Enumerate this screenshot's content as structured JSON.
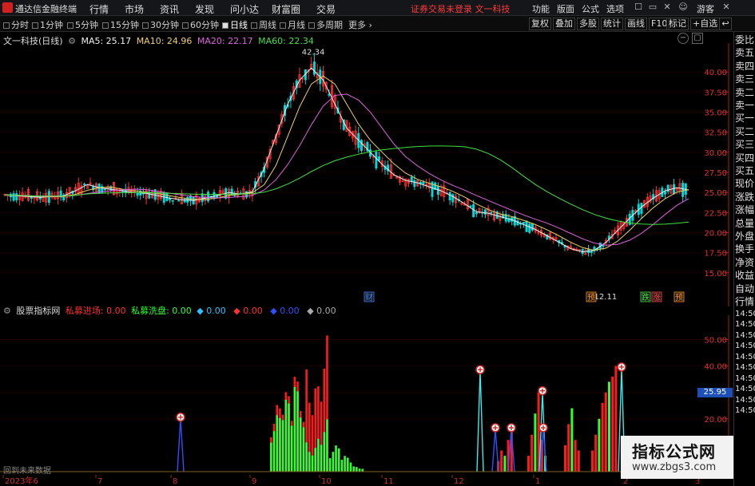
{
  "titlebar": {
    "app_name": "通达信金融终端",
    "menus": [
      "行情",
      "市场",
      "资讯",
      "发现",
      "问小达",
      "财富圈",
      "交易"
    ],
    "notice": "证券交易未登录 文一科技",
    "right_menus": [
      "功能",
      "版面",
      "公式",
      "选项"
    ],
    "search_label": "游客"
  },
  "toolbar": {
    "periods": [
      "分时",
      "1分钟",
      "5分钟",
      "15分钟",
      "30分钟",
      "60分钟",
      "日线",
      "周线",
      "月线",
      "多周期",
      "更多"
    ],
    "active_period": "日线",
    "right_buttons": [
      "复权",
      "叠加",
      "多股",
      "统计",
      "画线",
      "F10",
      "标记",
      "+自选"
    ],
    "back_icon": "back-arrow-icon"
  },
  "main_header": {
    "stock": "文一科技(日线)",
    "ma5": "MA5: 25.17",
    "ma10": "MA10: 24.96",
    "ma20": "MA20: 22.17",
    "ma60": "MA60: 22.34",
    "colors": {
      "ma5": "#f0f0f0",
      "ma10": "#f0d060",
      "ma20": "#e060e0",
      "ma60": "#40e040"
    }
  },
  "sub_header": {
    "name": "股票指标网",
    "items": [
      {
        "label": "私募进场: 0.00",
        "color": "#ff3030"
      },
      {
        "label": "私募洗盘: 0.00",
        "color": "#30ff30"
      },
      {
        "label": "0.00",
        "color": "#30c0ff"
      },
      {
        "label": "0.00",
        "color": "#ff3030"
      },
      {
        "label": "0.00",
        "color": "#3050ff"
      },
      {
        "label": "0.00",
        "color": "#aaaaaa"
      }
    ]
  },
  "price_axis": [
    "40.00",
    "37.50",
    "35.00",
    "32.50",
    "30.00",
    "27.50",
    "25.00",
    "22.50",
    "20.00",
    "17.50",
    "15.00"
  ],
  "sub_axis": [
    "50.00",
    "40.00",
    "30.00",
    "20.00"
  ],
  "date_axis": [
    "2023年6",
    "7",
    "8",
    "9",
    "10",
    "11",
    "12",
    "1",
    "2",
    "3"
  ],
  "annotations": {
    "high": "42.34",
    "low": "12.11",
    "event_markers": [
      {
        "label": "财",
        "color": "#4080ff"
      },
      {
        "label": "预",
        "color": "#ff9020"
      },
      {
        "label": "跌",
        "color": "#40e040"
      },
      {
        "label": "涨",
        "color": "#ff4040"
      },
      {
        "label": "预",
        "color": "#ff9020"
      }
    ]
  },
  "side_panel": [
    "委比",
    "卖五",
    "卖四",
    "卖三",
    "卖二",
    "卖一",
    "买一",
    "买二",
    "买三",
    "买四",
    "买五",
    "现价",
    "涨跌",
    "涨幅",
    "总量",
    "外盘",
    "换手",
    "净资",
    "收益",
    "自动",
    "行情",
    "14:50",
    "14:50",
    "14:50",
    "14:50",
    "14:50",
    "14:50",
    "14:50",
    "14:50",
    "14:50",
    "14:50"
  ],
  "price_tag": "25.95",
  "bottom_notice": "回到未来数据",
  "watermark": {
    "line1": "指标公式网",
    "line2": "www.zbgs3.com"
  },
  "chart_data": {
    "type": "bar",
    "title": "",
    "price_ylim": [
      12,
      43
    ],
    "sub_ylim": [
      0,
      58
    ],
    "series": [
      {
        "name": "MA5",
        "values": [
          24.7,
          24.6,
          24.5,
          24.4,
          24.5,
          24.6,
          25.2,
          26.0,
          25.6,
          25.4,
          25.2,
          25.0,
          24.9,
          24.6,
          24.3,
          24.1,
          24.0,
          24.3,
          24.6,
          25.0,
          24.8,
          25.1,
          28.0,
          32.0,
          36.0,
          39.0,
          40.5,
          39.0,
          36.0,
          33.0,
          31.5,
          30.0,
          28.5,
          27.2,
          26.5,
          26.2,
          25.7,
          25.2,
          24.5,
          23.6,
          22.6,
          22.4,
          22.0,
          21.6,
          21.0,
          20.4,
          19.6,
          18.8,
          18.0,
          17.6,
          17.8,
          18.8,
          20.3,
          21.8,
          23.2,
          24.3,
          25.2,
          25.6,
          25.3
        ]
      }
    ],
    "sub_bars_red": [
      0,
      0,
      0,
      0,
      0,
      0,
      0,
      0,
      0,
      0,
      0,
      0,
      0,
      0,
      0,
      0,
      0,
      0,
      0,
      0,
      0,
      0,
      0,
      26,
      31,
      37,
      42,
      52,
      0,
      0,
      0,
      0,
      0,
      0,
      0,
      0,
      0,
      0,
      0,
      0,
      0,
      0,
      0,
      0,
      0,
      0,
      0,
      0,
      0,
      0,
      0,
      0,
      0,
      0,
      0,
      0,
      0,
      0,
      0
    ],
    "sub_bars_green": [
      0,
      0,
      0,
      0,
      0,
      0,
      0,
      0,
      0,
      0,
      0,
      0,
      0,
      0,
      0,
      0,
      0,
      0,
      0,
      0,
      0,
      0,
      0,
      22,
      28,
      33,
      12,
      20,
      10,
      6,
      2,
      0,
      0,
      0,
      0,
      0,
      0,
      0,
      0,
      0,
      0,
      0,
      0,
      0,
      0,
      0,
      0,
      0,
      0,
      0,
      0,
      0,
      0,
      0,
      0,
      0,
      0,
      0,
      0
    ]
  }
}
